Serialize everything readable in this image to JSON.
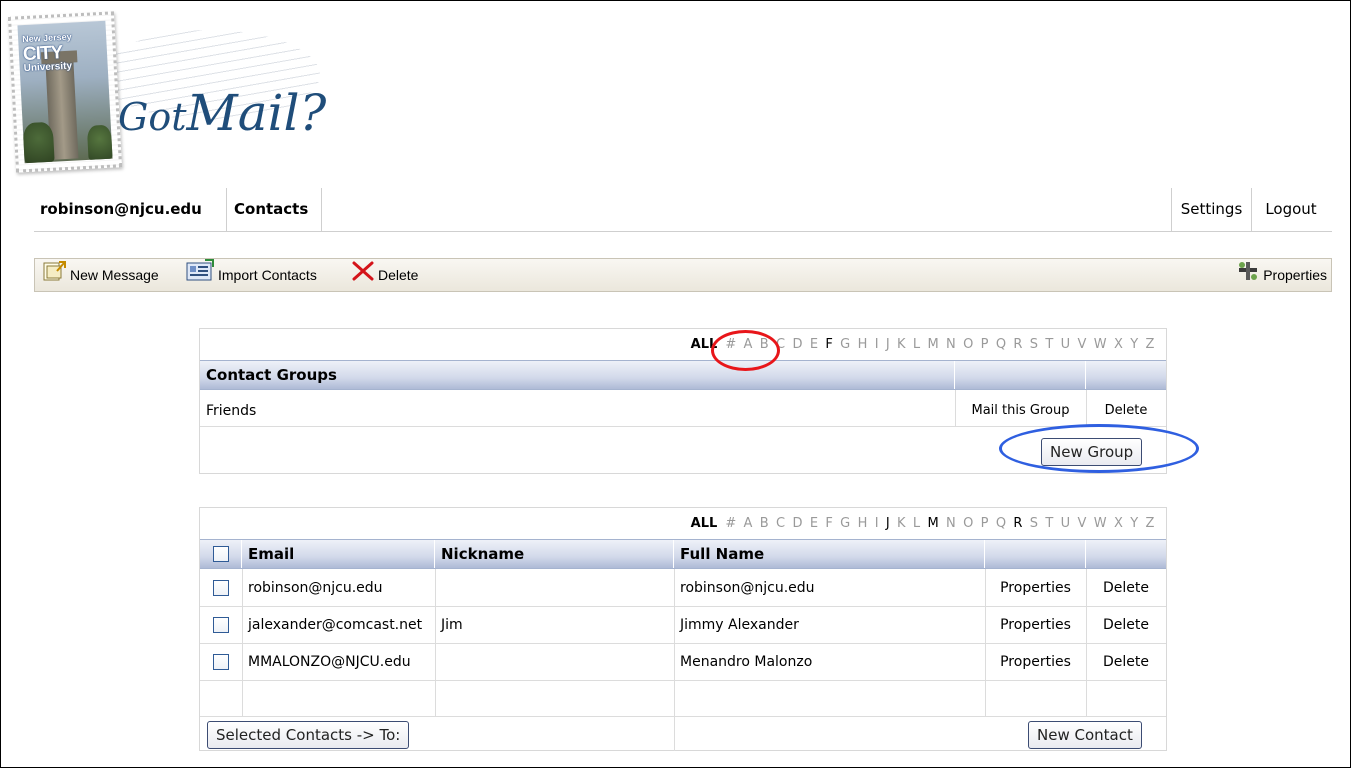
{
  "brand": {
    "stamp_line1": "New Jersey",
    "stamp_line2": "CITY",
    "stamp_line3": "University",
    "title_part1": "Got",
    "title_part2": "Mail?"
  },
  "nav": {
    "user": "robinson@njcu.edu",
    "contacts": "Contacts",
    "settings": "Settings",
    "logout": "Logout"
  },
  "toolbar": {
    "new_message": "New Message",
    "import_contacts": "Import Contacts",
    "delete": "Delete",
    "properties": "Properties"
  },
  "alphabet": {
    "all": "ALL",
    "letters_groups": "# A B C D E F G H I J K L M N O P Q R S T U V W X Y Z",
    "letters_contacts": "# A B C D E F G H I J K L M N O P Q R S T U V W X Y Z"
  },
  "groups": {
    "header": "Contact Groups",
    "rows": [
      {
        "name": "Friends",
        "mail_action": "Mail this Group",
        "delete_action": "Delete"
      }
    ],
    "new_group_button": "New Group"
  },
  "contacts": {
    "columns": {
      "email": "Email",
      "nickname": "Nickname",
      "full_name": "Full Name"
    },
    "rows": [
      {
        "email": "robinson@njcu.edu",
        "nickname": "",
        "full_name": "robinson@njcu.edu",
        "properties": "Properties",
        "delete": "Delete"
      },
      {
        "email": "jalexander@comcast.net",
        "nickname": "Jim",
        "full_name": "Jimmy Alexander",
        "properties": "Properties",
        "delete": "Delete"
      },
      {
        "email": "MMALONZO@NJCU.edu",
        "nickname": "",
        "full_name": "Menandro Malonzo",
        "properties": "Properties",
        "delete": "Delete"
      }
    ],
    "selected_to_button": "Selected Contacts -> To:",
    "new_contact_button": "New Contact"
  },
  "annotations": {
    "red_circle_color": "#e8161a",
    "blue_circle_color": "#2f5fe0"
  }
}
